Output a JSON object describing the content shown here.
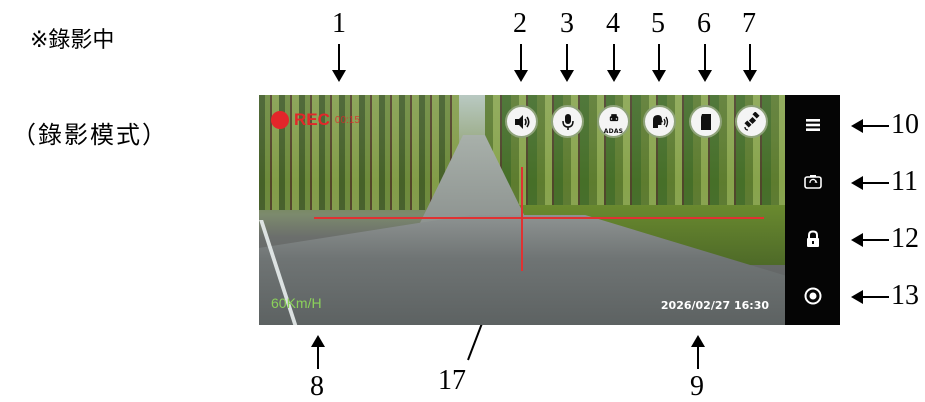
{
  "side": {
    "title": "※錄影中",
    "mode": "（錄影模式）"
  },
  "callouts": {
    "n1": "1",
    "n2": "2",
    "n3": "3",
    "n4": "4",
    "n5": "5",
    "n6": "6",
    "n7": "7",
    "n8": "8",
    "n9": "9",
    "n10": "10",
    "n11": "11",
    "n12": "12",
    "n13": "13",
    "n17": "17"
  },
  "screen": {
    "rec_label": "REC",
    "rec_time": "00:15",
    "speed": "60Km/H",
    "datetime": "2026/02/27 16:30",
    "crosshair_color": "#e03232",
    "status_icons": [
      {
        "name": "speaker-icon"
      },
      {
        "name": "microphone-icon"
      },
      {
        "name": "adas-car-icon",
        "label": "ADAS"
      },
      {
        "name": "voice-prompt-icon"
      },
      {
        "name": "sd-card-icon"
      },
      {
        "name": "gps-satellite-icon"
      }
    ],
    "sidebar_buttons": [
      {
        "name": "menu-icon"
      },
      {
        "name": "switch-camera-icon"
      },
      {
        "name": "lock-icon"
      },
      {
        "name": "record-icon"
      }
    ]
  },
  "colors": {
    "rec_red": "#e3262a",
    "speed_green": "#8bd15a",
    "sidebar_bg": "#050505"
  }
}
